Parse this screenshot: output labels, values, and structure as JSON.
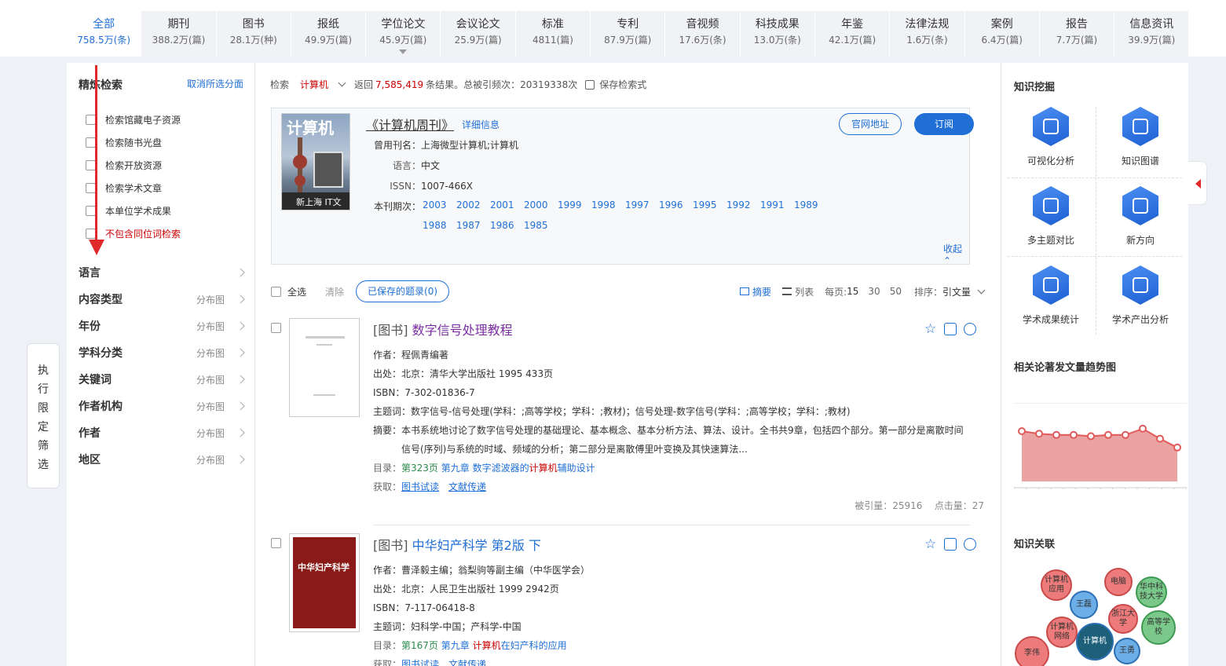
{
  "tabs": [
    {
      "label": "全部",
      "count": "758.5万(条)"
    },
    {
      "label": "期刊",
      "count": "388.2万(篇)"
    },
    {
      "label": "图书",
      "count": "28.1万(种)"
    },
    {
      "label": "报纸",
      "count": "49.9万(篇)"
    },
    {
      "label": "学位论文",
      "count": "45.9万(篇)"
    },
    {
      "label": "会议论文",
      "count": "25.9万(篇)"
    },
    {
      "label": "标准",
      "count": "4811(篇)"
    },
    {
      "label": "专利",
      "count": "87.9万(篇)"
    },
    {
      "label": "音视频",
      "count": "17.6万(条)"
    },
    {
      "label": "科技成果",
      "count": "13.0万(条)"
    },
    {
      "label": "年鉴",
      "count": "42.1万(篇)"
    },
    {
      "label": "法律法规",
      "count": "1.6万(条)"
    },
    {
      "label": "案例",
      "count": "6.4万(篇)"
    },
    {
      "label": "报告",
      "count": "7.7万(篇)"
    },
    {
      "label": "信息资讯",
      "count": "39.9万(篇)"
    }
  ],
  "side_button": [
    "执",
    "行",
    "限",
    "定",
    "筛",
    "选"
  ],
  "left": {
    "title": "精炼检索",
    "cancel": "取消所选分面",
    "checkboxes": [
      "检索馆藏电子资源",
      "检索随书光盘",
      "检索开放资源",
      "检索学术文章",
      "本单位学术成果",
      "不包含同位词检索"
    ],
    "facets": [
      {
        "name": "语言",
        "dist": ""
      },
      {
        "name": "内容类型",
        "dist": "分布图"
      },
      {
        "name": "年份",
        "dist": "分布图"
      },
      {
        "name": "学科分类",
        "dist": "分布图"
      },
      {
        "name": "关键词",
        "dist": "分布图"
      },
      {
        "name": "作者机构",
        "dist": "分布图"
      },
      {
        "name": "作者",
        "dist": "分布图"
      },
      {
        "name": "地区",
        "dist": "分布图"
      }
    ]
  },
  "search": {
    "label": "检索",
    "keyword": "计算机",
    "return_prefix": "返回",
    "result_count": "7,585,419",
    "return_suffix": "条结果。总被引频次：20319338次",
    "save": "保存检索式"
  },
  "journal": {
    "cover_title": "计算机",
    "cover_bottom": "新上海 IT文明",
    "title": "《计算机周刊》",
    "detail": "详细信息",
    "former_label": "曾用刊名：",
    "former": "上海微型计算机;计算机",
    "lang_label": "语言：",
    "lang": "中文",
    "issn_label": "ISSN：",
    "issn": "1007-466X",
    "years_label": "本刊期次：",
    "years": [
      "2003",
      "2002",
      "2001",
      "2000",
      "1999",
      "1998",
      "1997",
      "1996",
      "1995",
      "1992",
      "1991",
      "1989",
      "1988",
      "1987",
      "1986",
      "1985"
    ],
    "btn_site": "官网地址",
    "btn_sub": "订阅",
    "collapse": "收起"
  },
  "toolbar": {
    "select_all": "全选",
    "clear": "清除",
    "saved": "已保存的题录(0)",
    "abstract": "摘要",
    "list": "列表",
    "per_page_label": "每页:",
    "pp15": "15",
    "pp30": "30",
    "pp50": "50",
    "sort_label": "排序：",
    "sort_val": "引文量"
  },
  "records": [
    {
      "tag": "[图书]",
      "title": "数字信号处理教程",
      "author": "作者：程佩青编著",
      "source": "出处：北京：清华大学出版社 1995 433页",
      "isbn": "ISBN：7-302-01836-7",
      "subject": "主题词：数字信号-信号处理(学科：;高等学校；学科：;教材)；信号处理-数字信号(学科：;高等学校；学科：;教材)",
      "abstract1": "摘要：本书系统地讨论了数字信号处理的基础理论、基本概念、基本分析方法、算法、设计。全书共9章，包括四个部分。第一部分是离散时间",
      "abstract2": "信号(序列)与系统的时域、频域的分析；第二部分是离散傅里叶变换及其快速算法...",
      "toc_label": "目录：",
      "toc_page": "第323页",
      "toc_ch": "第九章",
      "toc_a": "数字滤波器的",
      "toc_kw": "计算机",
      "toc_b": "辅助设计",
      "get_label": "获取：",
      "get1": "图书试读",
      "get2": "文献传递",
      "cited": "被引量：25916",
      "clicks": "点击量：27"
    },
    {
      "tag": "[图书]",
      "title": "中华妇产科学 第2版 下",
      "cover": "中华妇产科学",
      "author": "作者：曹泽毅主编；翁梨驹等副主编（中华医学会）",
      "source": "出处：北京：人民卫生出版社 1999 2942页",
      "isbn": "ISBN：7-117-06418-8",
      "subject": "主题词：妇科学-中国；产科学-中国",
      "toc_label": "目录：",
      "toc_page": "第167页",
      "toc_ch": "第九章",
      "toc_kw": "计算机",
      "toc_b": "在妇产科的应用",
      "get_label": "获取：",
      "get1": "图书试读",
      "get2": "文献传递"
    }
  ],
  "right": {
    "mining": "知识挖掘",
    "tools": [
      "可视化分析",
      "知识图谱",
      "多主题对比",
      "新方向",
      "学术成果统计",
      "学术产出分析"
    ],
    "trend_title": "相关论著发文量趋势图",
    "trend_values": [
      100,
      98,
      97,
      97,
      96,
      97,
      97,
      102,
      94,
      87
    ],
    "relation_title": "知识关联",
    "bubbles": [
      "计算机应用",
      "电脑",
      "华中科技大学",
      "王磊",
      "计算机网络",
      "计算机",
      "浙江大学",
      "高等学校",
      "李伟",
      "王勇"
    ]
  },
  "colors": {
    "accent": "#1f6fd6",
    "highlight": "#c00",
    "arrow": "#e0292b"
  }
}
